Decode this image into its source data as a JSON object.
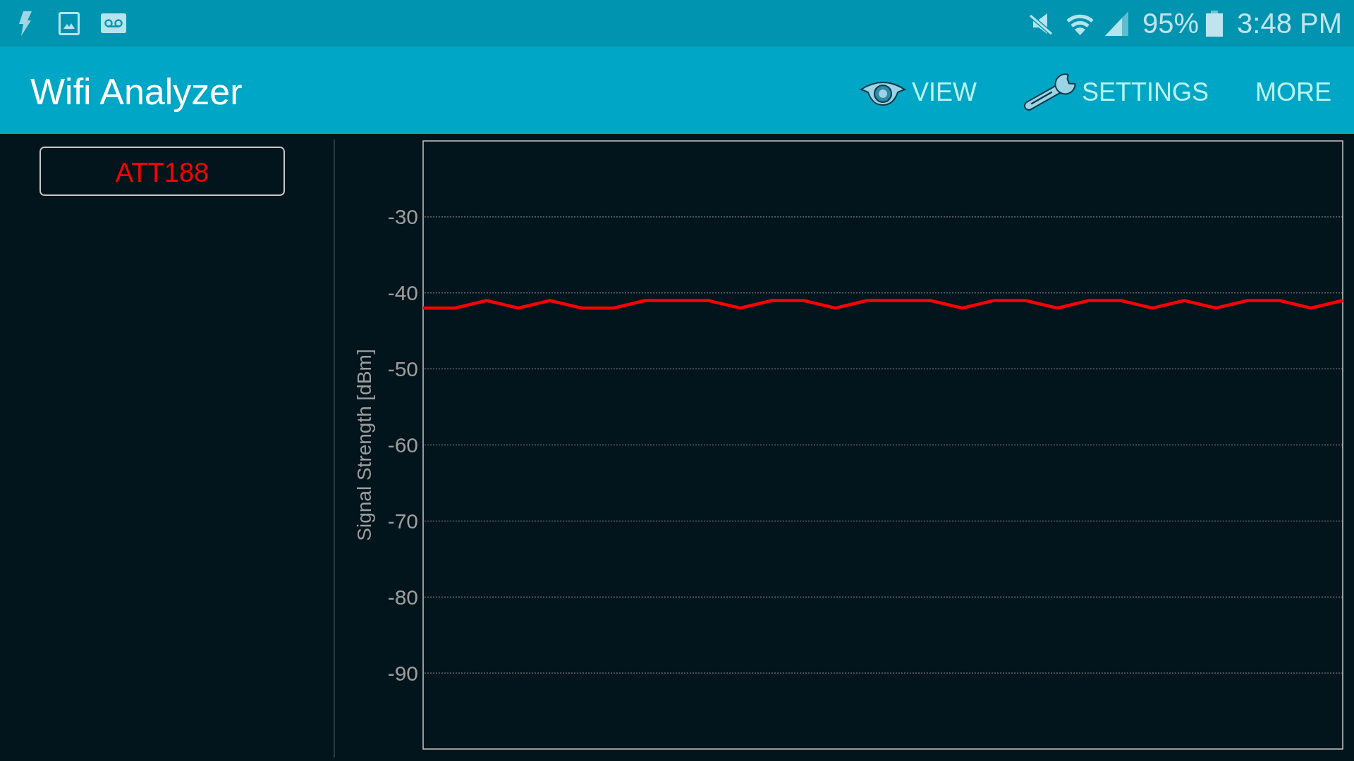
{
  "status_bar": {
    "battery": "95%",
    "time": "3:48 PM"
  },
  "app_bar": {
    "title": "Wifi Analyzer",
    "actions": [
      {
        "label": "VIEW",
        "kind": "view"
      },
      {
        "label": "SETTINGS",
        "kind": "settings"
      },
      {
        "label": "MORE",
        "kind": "overflow"
      }
    ]
  },
  "chart_data": {
    "type": "line",
    "ylabel": "Signal Strength [dBm]",
    "categories": [
      null,
      null,
      null,
      null,
      null,
      null,
      null,
      null,
      null,
      null,
      null,
      null,
      null,
      null,
      null,
      null,
      null,
      null,
      null,
      null,
      null,
      null,
      null,
      null,
      null,
      null,
      null,
      null,
      null,
      null
    ],
    "series": [
      {
        "name": "ATT188",
        "color": "#ff0000",
        "values": [
          -42,
          -42,
          -41,
          -42,
          -41,
          -42,
          -42,
          -41,
          -41,
          -41,
          -42,
          -41,
          -41,
          -42,
          -41,
          -41,
          -41,
          -42,
          -41,
          -41,
          -42,
          -41,
          -41,
          -42,
          -41,
          -42,
          -41,
          -41,
          -42,
          -41
        ]
      }
    ],
    "ylim": [
      -100,
      -20
    ],
    "yticks": [
      -30,
      -40,
      -50,
      -60,
      -70,
      -80,
      -90
    ],
    "grid": true
  }
}
